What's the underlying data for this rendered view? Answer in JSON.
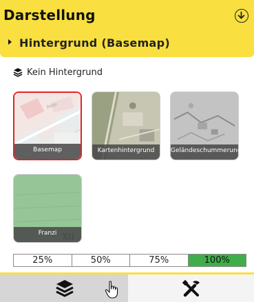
{
  "header": {
    "title": "Darstellung"
  },
  "subheader": {
    "title": "Hintergrund (Basemap)"
  },
  "no_basemap": {
    "label": "Kein Hintergrund"
  },
  "tiles": [
    {
      "label": "Basemap",
      "selected": true
    },
    {
      "label": "Kartenhintergrund",
      "selected": false
    },
    {
      "label": "Geländeschummerung (ALS)",
      "selected": false
    },
    {
      "label": "Franzi",
      "selected": false
    }
  ],
  "opacity": {
    "options": [
      "25%",
      "50%",
      "75%",
      "100%"
    ],
    "selected": "100%"
  },
  "colors": {
    "header_bg": "#f9df3f",
    "selected_border": "#e02424",
    "opacity_selected": "#3fae4a"
  },
  "toolbar": {
    "tabs": [
      {
        "icon": "layers-icon",
        "active": true
      },
      {
        "icon": "tools-icon",
        "active": false
      }
    ]
  }
}
